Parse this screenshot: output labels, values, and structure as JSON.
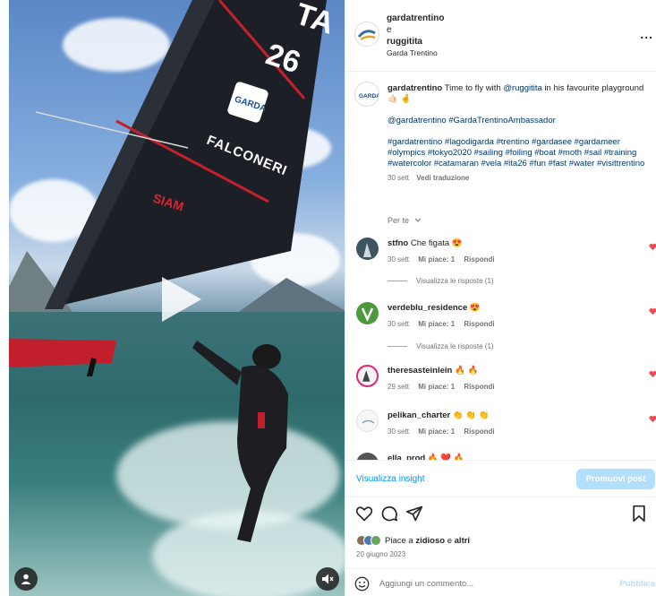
{
  "post_header": {
    "owner": "gardatrentino",
    "separator": "e",
    "collaborator": "ruggitita",
    "subtitle": "Garda Trentino",
    "more_label": "..."
  },
  "video": {
    "sail_number_top": "TA",
    "sail_number": "26",
    "sail_brand": "FALCONERI",
    "sail_logo": "GARDA",
    "sponsor": "SIAM"
  },
  "caption": {
    "username": "gardatrentino",
    "text_before": "Time to fly with",
    "mention": "@ruggitita",
    "text_after": "in his favourite playground 🤙🏻 🤞",
    "line2": "@gardatrentino #GardaTrentinoAmbassador",
    "hashtags": "#gardatrentino #lagodigarda #trentino #gardasee #gardameer #olympics #tokyo2020 #sailing #foiling #boat #moth #sail #training #watercolor #catamaran #vela #ita26 #fun #fast #water #visittrentino",
    "date": "30 sett",
    "translate": "Vedi traduzione"
  },
  "filter_label": "Per te",
  "comments": [
    {
      "user": "stfno",
      "text": "Che figata 😍",
      "date": "30 sett",
      "likes": "Mi piace: 1",
      "reply": "Rispondi",
      "replies": "Visualizza le risposte (1)"
    },
    {
      "user": "verdeblu_residence",
      "text": "😍",
      "date": "30 sett",
      "likes": "Mi piace: 1",
      "reply": "Rispondi",
      "replies": "Visualizza le risposte (1)"
    },
    {
      "user": "theresasteinlein",
      "text": "🔥 🔥",
      "date": "29 sett",
      "likes": "Mi piace: 1",
      "reply": "Rispondi",
      "replies": ""
    },
    {
      "user": "pelikan_charter",
      "text": "👏 👏 👏",
      "date": "30 sett",
      "likes": "Mi piace: 1",
      "reply": "Rispondi",
      "replies": ""
    },
    {
      "user": "ella_prod",
      "text": "🔥 ❤️ 🔥",
      "date": "",
      "likes": "",
      "reply": "",
      "replies": ""
    }
  ],
  "insights_label": "Visualizza insight",
  "promote_label": "Promuovi post",
  "likes": {
    "prefix": "Piace a",
    "user": "zidioso",
    "middle": "e",
    "others": "altri"
  },
  "post_date": "20 giugno 2023",
  "composer": {
    "placeholder": "Aggiungi un commento...",
    "publish_label": "Pubblica"
  },
  "colors": {
    "accent": "#0095f6",
    "accent_disabled": "#b2dffc",
    "heart": "#ed4956",
    "link": "#00376b",
    "muted": "#737373"
  }
}
